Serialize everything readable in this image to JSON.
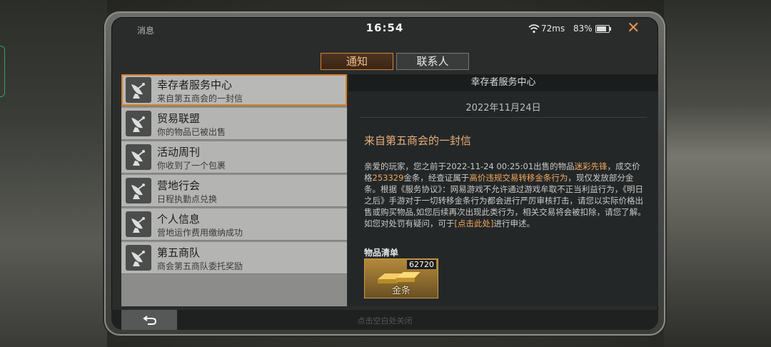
{
  "status": {
    "title": "消息",
    "clock": "16:54",
    "ping": "72ms",
    "battery": "83%"
  },
  "tabs": [
    {
      "label": "通知",
      "active": true
    },
    {
      "label": "联系人",
      "active": false
    }
  ],
  "messages": [
    {
      "title": "幸存者服务中心",
      "subtitle": "来自第五商会的一封信"
    },
    {
      "title": "贸易联盟",
      "subtitle": "你的物品已被出售"
    },
    {
      "title": "活动周刊",
      "subtitle": "你收到了一个包裹"
    },
    {
      "title": "营地行会",
      "subtitle": "日程执勤点兑换"
    },
    {
      "title": "个人信息",
      "subtitle": "营地运作费用缴纳成功"
    },
    {
      "title": "第五商队",
      "subtitle": "商会第五商队委托奖励"
    }
  ],
  "detail": {
    "header": "幸存者服务中心",
    "date": "2022年11月24日",
    "subject": "来自第五商会的一封信",
    "body_parts": {
      "p1": "亲爱的玩家，您之前于2022-11-24 00:25:01出售的物品",
      "h1": "迷彩先锋",
      "p2": "，成交价格",
      "h2": "253329",
      "p3": "金条，经查证属于",
      "h3": "高价违规交易转移金条行为",
      "p4": "，现仅发放部分金条。根据《服务协议》：网易游戏不允许通过游戏牟取不正当利益行为，《明日之后》手游对于一切转移金条行为都会进行严厉审核打击，请您以实际价格出售或购买物品,如您后续再次出现此类行为，相关交易将会被扣除，请您了解。如您对处罚有疑问，可于",
      "h4": "[点击此处]",
      "p5": "进行申述。"
    },
    "items_label": "物品清单",
    "item": {
      "name": "金条",
      "qty": "62720"
    }
  },
  "footer": {
    "hint": "点击空白处关闭"
  },
  "colors": {
    "accent": "#d9822b",
    "highlight": "#f0a860"
  }
}
